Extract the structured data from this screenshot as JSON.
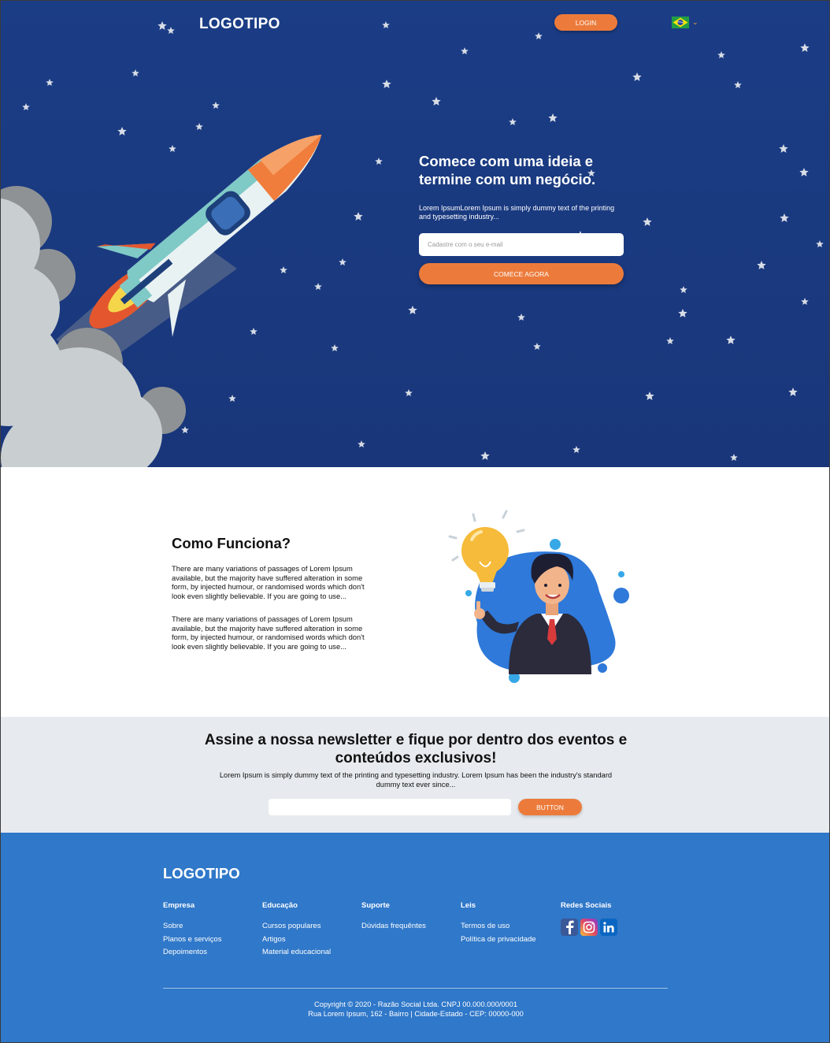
{
  "header": {
    "logo": "LOGOTIPO",
    "login_label": "LOGIN",
    "language_flag": "brazil-flag-icon"
  },
  "hero": {
    "title_line1": "Comece com uma ideia e",
    "title_line2": "termine com um negócio.",
    "subtitle": "Lorem IpsumLorem Ipsum is simply dummy text of the printing and typesetting industry...",
    "email_placeholder": "Cadastre com o seu e-mail",
    "cta_label": "COMECE AGORA"
  },
  "how": {
    "title": "Como Funciona?",
    "paragraph1": "There are many variations of passages of Lorem Ipsum available, but the majority have suffered alteration in some form, by injected humour, or randomised words which don't look even slightly believable. If you are going to use...",
    "paragraph2": "There are many variations of passages of Lorem Ipsum available, but the majority have suffered alteration in some form, by injected humour, or randomised words which don't look even slightly believable. If you are going to use..."
  },
  "newsletter": {
    "title_line1": "Assine a nossa newsletter e fique por dentro dos eventos e",
    "title_line2": "conteúdos exclusivos!",
    "subtitle": "Lorem Ipsum is simply dummy text of the printing and typesetting industry. Lorem Ipsum has been the industry's standard dummy text ever since...",
    "input_value": "",
    "button_label": "BUTTON"
  },
  "footer": {
    "logo": "LOGOTIPO",
    "columns": [
      {
        "heading": "Empresa",
        "links": [
          "Sobre",
          "Planos e serviços",
          "Depoimentos"
        ]
      },
      {
        "heading": "Educação",
        "links": [
          "Cursos populares",
          "Artigos",
          "Material educacional"
        ]
      },
      {
        "heading": "Suporte",
        "links": [
          "Dúvidas frequêntes"
        ]
      },
      {
        "heading": "Leis",
        "links": [
          "Termos de uso",
          "Política de privacidade"
        ]
      },
      {
        "heading": "Redes Sociais",
        "icons": [
          "facebook-icon",
          "instagram-icon",
          "linkedin-icon"
        ]
      }
    ],
    "copyright_line1": "Copyright © 2020 - Razão Social Ltda. CNPJ 00.000.000/0001",
    "copyright_line2": "Rua Lorem Ipsum, 162 - Bairro | Cidade-Estado - CEP: 00000-000"
  },
  "colors": {
    "hero_bg": "#1b3d86",
    "accent_orange": "#ec7b3b",
    "footer_blue": "#3078c9",
    "newsletter_bg": "#e7ebef"
  }
}
